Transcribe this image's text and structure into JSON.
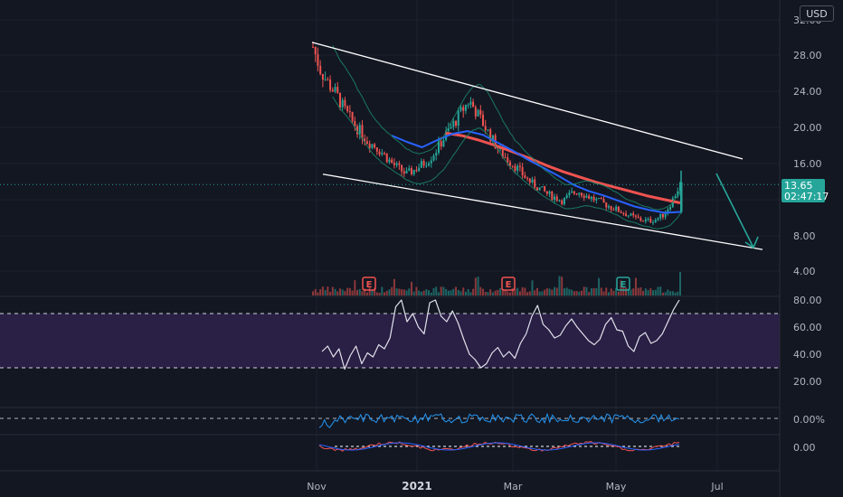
{
  "currency": "USD",
  "price_axis": {
    "ticks": [
      "32.00",
      "28.00",
      "24.00",
      "20.00",
      "16.00",
      "8.00",
      "4.00"
    ]
  },
  "last_price": {
    "value": "13.65",
    "countdown": "02:47:17",
    "color": "#26a69a"
  },
  "rsi_axis": {
    "ticks": [
      "80.00",
      "60.00",
      "40.00",
      "20.00"
    ],
    "band_color": "#2a1f45"
  },
  "osc1_axis": {
    "ticks": [
      "0.00%"
    ]
  },
  "osc2_axis": {
    "ticks": [
      "0.00"
    ]
  },
  "time_axis": {
    "labels": [
      "Nov",
      "2021",
      "Mar",
      "May",
      "Jul"
    ]
  },
  "earnings_markers": [
    "E",
    "E",
    "E"
  ],
  "colors": {
    "up": "#26a69a",
    "down": "#ef5350",
    "ma_slow": "#ef5350",
    "ma_mid": "#2962ff",
    "rsi_line": "#e0e3eb",
    "channel": "#ffffff",
    "arrow": "#26a69a"
  },
  "chart_data": [
    {
      "type": "line",
      "title": "",
      "series": [
        {
          "values": [
            29,
            26.3,
            24.9,
            23.7,
            22.0,
            20.7,
            19.6,
            18.5,
            17.9,
            17.1,
            16.1,
            15.4,
            14.8,
            15.3,
            15.9,
            16.6,
            17.8,
            19.2,
            20.4,
            21.8,
            23.0,
            21.6,
            20.1,
            18.6,
            17.2,
            16.4,
            15.6,
            14.6,
            13.8,
            13.2,
            12.6,
            12.2,
            11.8,
            12.6,
            12.9,
            12.4,
            12.0,
            11.6,
            11.2,
            10.8,
            10.4,
            10.0,
            9.7,
            9.6,
            9.8,
            10.4,
            11.9,
            13.65
          ]
        }
      ],
      "moving_averages": [
        {
          "color": "#ef5350",
          "values": [
            19.4,
            19.1,
            18.6,
            18.0,
            17.3,
            16.6,
            15.8,
            15.1,
            14.5,
            13.9,
            13.4,
            12.9,
            12.4,
            12.0,
            11.6
          ]
        },
        {
          "color": "#2962ff",
          "values": [
            19.1,
            18.4,
            17.8,
            18.6,
            19.3,
            19.6,
            19.2,
            18.3,
            17.4,
            16.4,
            15.5,
            14.6,
            13.6,
            12.9,
            12.4,
            11.8,
            11.2,
            10.8,
            10.5,
            10.6
          ]
        }
      ],
      "channel": {
        "upper": [
          29.5,
          16.5
        ],
        "lower": [
          14.8,
          6.4
        ]
      }
    },
    {
      "type": "line",
      "title": "",
      "ylim": [
        0,
        100
      ],
      "values": [
        42,
        46,
        38,
        44,
        29,
        39,
        46,
        33,
        41,
        38,
        47,
        44,
        52,
        75,
        80,
        64,
        70,
        60,
        55,
        78,
        80,
        68,
        64,
        72,
        63,
        51,
        40,
        36,
        30,
        33,
        41,
        45,
        38,
        42,
        37,
        48,
        55,
        68,
        76,
        62,
        58,
        52,
        54,
        61,
        66,
        60,
        55,
        50,
        47,
        51,
        62,
        67,
        58,
        57,
        46,
        42,
        53,
        56,
        48,
        50,
        55,
        64,
        73,
        80
      ]
    }
  ]
}
